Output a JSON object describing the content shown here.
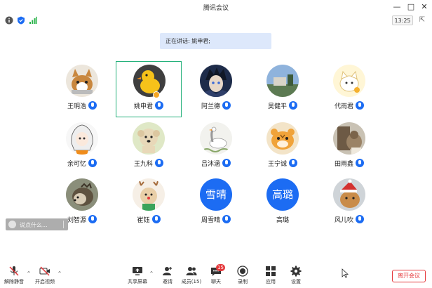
{
  "window": {
    "title": "腾讯会议",
    "clock": "13:25"
  },
  "speaker_banner": "正在讲话: 姚申君;",
  "participants": [
    {
      "name": "王明浩",
      "avatar": "cat-icon"
    },
    {
      "name": "姚申君",
      "avatar": "duck-icon"
    },
    {
      "name": "阿兰德",
      "avatar": "anime-boy-icon"
    },
    {
      "name": "吴健平",
      "avatar": "landscape-icon"
    },
    {
      "name": "代雨君",
      "avatar": "cat-cartoon-icon"
    },
    {
      "name": "余可忆",
      "avatar": "anime-girl-icon"
    },
    {
      "name": "王九科",
      "avatar": "puppy-icon"
    },
    {
      "name": "吕沐涵",
      "avatar": "goose-icon"
    },
    {
      "name": "王宁诚",
      "avatar": "tiger-cartoon-icon"
    },
    {
      "name": "田雨鑫",
      "avatar": "photo-icon"
    },
    {
      "name": "刘智源",
      "avatar": "hedgehog-icon"
    },
    {
      "name": "崔钰",
      "avatar": "reindeer-cartoon-icon"
    },
    {
      "name": "周雪晴",
      "avatar_text": "雪晴"
    },
    {
      "name": "高璐",
      "avatar_text": "高璐"
    },
    {
      "name": "风儿吹",
      "avatar": "christmas-cat-icon"
    }
  ],
  "chat_input": {
    "placeholder": "说点什么..."
  },
  "toolbar": {
    "mute_label": "解除静音",
    "video_label": "开启视频",
    "share_label": "共享屏幕",
    "invite_label": "邀请",
    "members_label": "成员(15)",
    "chat_label": "聊天",
    "chat_badge": "15",
    "record_label": "录制",
    "apps_label": "应用",
    "settings_label": "设置",
    "end_label": "离开会议"
  },
  "colors": {
    "accent": "#1c6cf3",
    "active_border": "#23b07a",
    "danger": "#e5383b",
    "banner_bg": "#dde8fb"
  }
}
